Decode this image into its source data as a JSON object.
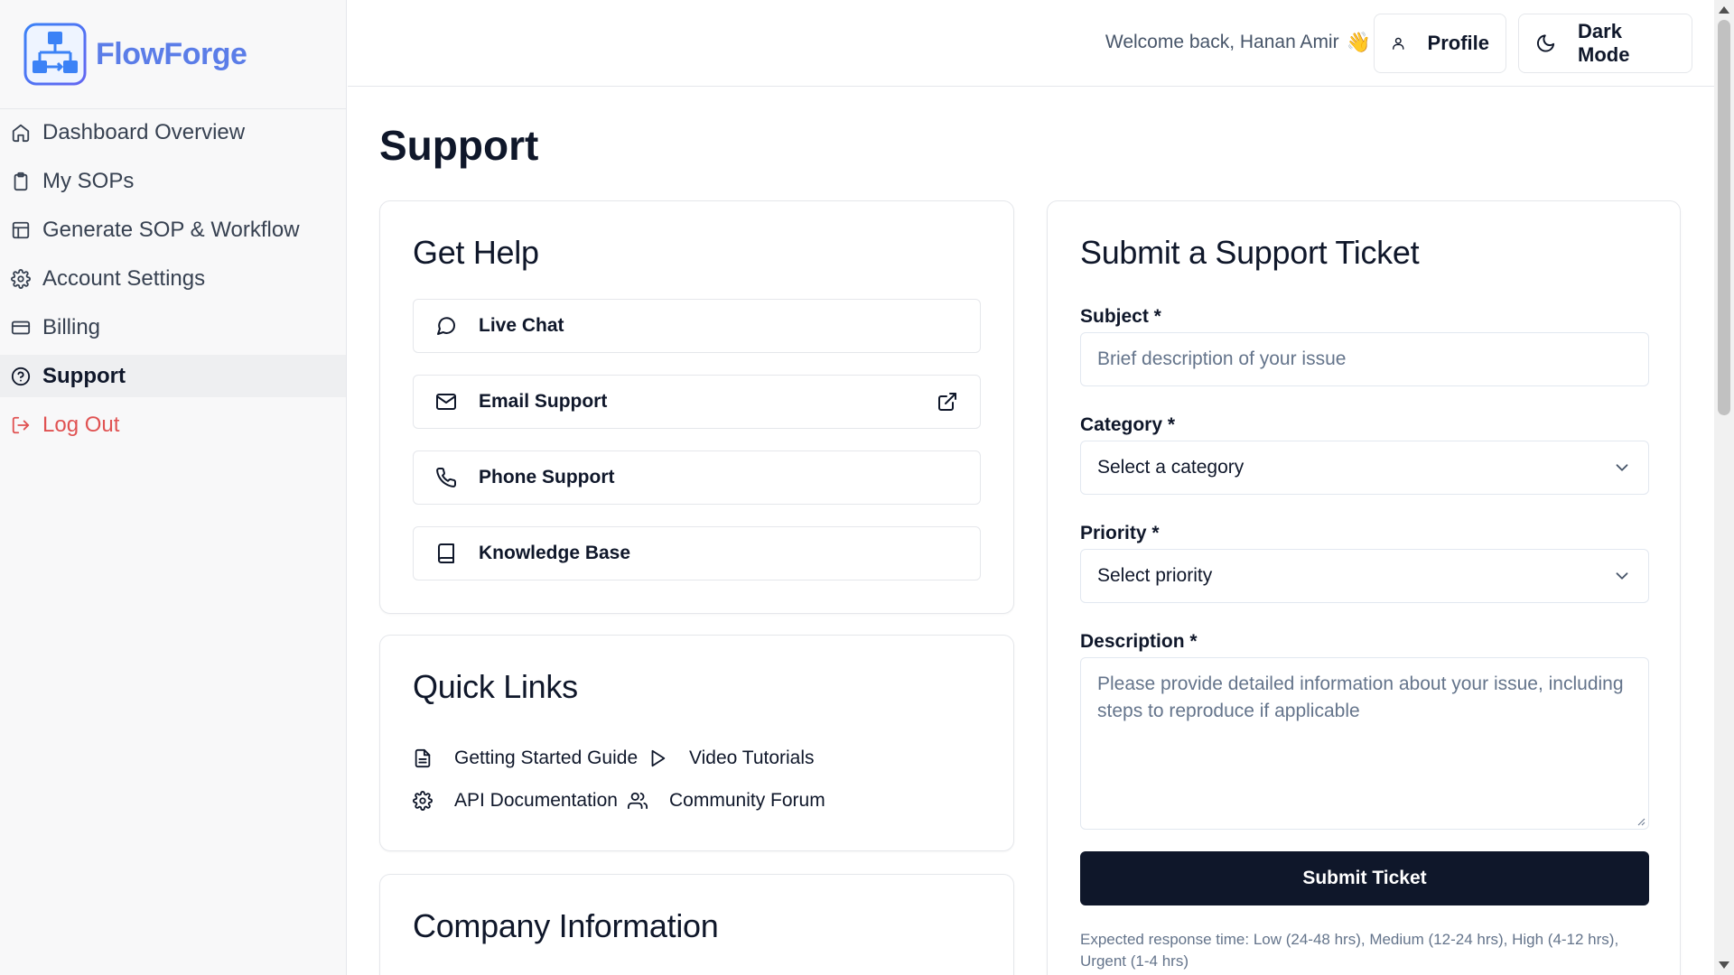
{
  "brand": {
    "name": "FlowForge"
  },
  "sidebar": {
    "items": [
      {
        "label": "Dashboard Overview",
        "icon": "home-icon"
      },
      {
        "label": "My SOPs",
        "icon": "clipboard-icon"
      },
      {
        "label": "Generate SOP & Workflow",
        "icon": "layout-icon"
      },
      {
        "label": "Account Settings",
        "icon": "gear-icon"
      },
      {
        "label": "Billing",
        "icon": "credit-card-icon"
      },
      {
        "label": "Support",
        "icon": "help-circle-icon",
        "active": true
      },
      {
        "label": "Log Out",
        "icon": "log-out-icon",
        "color": "#e05252"
      }
    ]
  },
  "header": {
    "welcome": "Welcome back, Hanan Amir",
    "wave": "👋",
    "profile_label": "Profile",
    "dark_mode_label": "Dark Mode"
  },
  "page": {
    "title": "Support"
  },
  "get_help": {
    "title": "Get Help",
    "items": [
      {
        "label": "Live Chat",
        "icon": "message-circle-icon"
      },
      {
        "label": "Email Support",
        "icon": "mail-icon",
        "external": true
      },
      {
        "label": "Phone Support",
        "icon": "phone-icon"
      },
      {
        "label": "Knowledge Base",
        "icon": "book-icon"
      }
    ]
  },
  "quick_links": {
    "title": "Quick Links",
    "items": [
      {
        "label": "Getting Started Guide",
        "icon": "file-text-icon"
      },
      {
        "label": "Video Tutorials",
        "icon": "play-icon"
      },
      {
        "label": "API Documentation",
        "icon": "gear-icon"
      },
      {
        "label": "Community Forum",
        "icon": "users-icon"
      }
    ]
  },
  "company": {
    "title": "Company Information"
  },
  "ticket": {
    "title": "Submit a Support Ticket",
    "subject_label": "Subject *",
    "subject_placeholder": "Brief description of your issue",
    "category_label": "Category *",
    "category_value": "Select a category",
    "priority_label": "Priority *",
    "priority_value": "Select priority",
    "description_label": "Description *",
    "description_placeholder": "Please provide detailed information about your issue, including steps to reproduce if applicable",
    "submit_label": "Submit Ticket",
    "response_note": "Expected response time: Low (24-48 hrs), Medium (12-24 hrs), High (4-12 hrs), Urgent (1-4 hrs)"
  },
  "colors": {
    "primary": "#0f172a",
    "brand": "#5b7de8",
    "danger": "#e05252",
    "muted": "#64748b"
  }
}
